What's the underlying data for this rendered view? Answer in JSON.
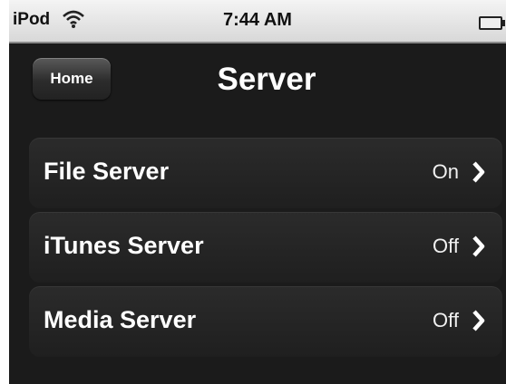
{
  "status_bar": {
    "carrier": "iPod",
    "time": "7:44 AM"
  },
  "nav": {
    "back_label": "Home",
    "title": "Server"
  },
  "items": [
    {
      "label": "File Server",
      "value": "On"
    },
    {
      "label": "iTunes Server",
      "value": "Off"
    },
    {
      "label": "Media Server",
      "value": "Off"
    }
  ],
  "icons": {
    "wifi": "wifi-icon",
    "battery": "battery-icon",
    "chevron": "chevron-right-icon"
  }
}
